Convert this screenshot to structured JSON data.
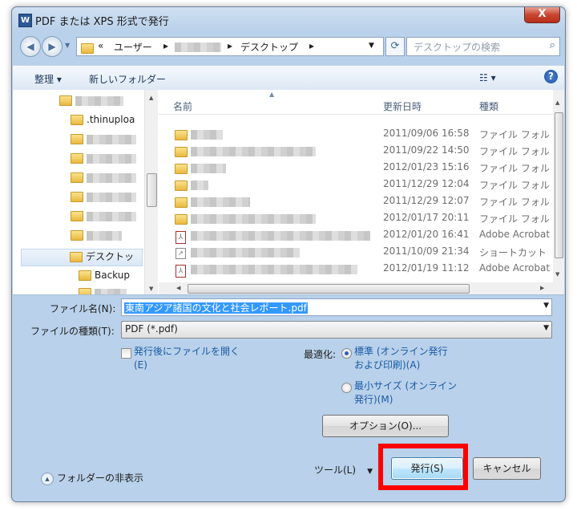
{
  "window": {
    "title": "PDF または XPS 形式で発行",
    "app_icon": "W",
    "close_label": "X"
  },
  "nav": {
    "back_icon": "◀",
    "forward_icon": "▶",
    "breadcrumb": [
      "«",
      "ユーザー",
      "▸",
      "▸",
      "デスクトップ",
      "▸"
    ],
    "search_placeholder": "デスクトップの検索"
  },
  "toolbar": {
    "organize": "整理 ▾",
    "new_folder": "新しいフォルダー",
    "view": "☷ ▾",
    "help": "?"
  },
  "tree": {
    "items": [
      ".thinuploa",
      "デスクトッ",
      "Backup"
    ]
  },
  "files": {
    "headers": {
      "name": "名前",
      "date": "更新日時",
      "type": "種類"
    },
    "rows": [
      {
        "date": "2011/09/06 16:58",
        "type": "ファイル フォル"
      },
      {
        "date": "2011/09/22 14:50",
        "type": "ファイル フォル"
      },
      {
        "date": "2012/01/23 15:16",
        "type": "ファイル フォル"
      },
      {
        "date": "2011/12/29 12:04",
        "type": "ファイル フォル"
      },
      {
        "date": "2011/12/29 12:07",
        "type": "ファイル フォル"
      },
      {
        "date": "2012/01/17 20:11",
        "type": "ファイル フォル"
      },
      {
        "date": "2012/01/20 16:41",
        "type": "Adobe Acrobat"
      },
      {
        "date": "2011/10/09 21:34",
        "type": "ショートカット"
      },
      {
        "date": "2012/01/19 11:12",
        "type": "Adobe Acrobat"
      }
    ]
  },
  "form": {
    "filename_label": "ファイル名(N):",
    "filename_value": "東南アジア諸国の文化と社会レポート.pdf",
    "filetype_label": "ファイルの種類(T):",
    "filetype_value": "PDF (*.pdf)",
    "open_after_line1": "発行後にファイルを開く",
    "open_after_line2": "(E)",
    "optimize_label": "最適化:",
    "standard_line1": "標準 (オンライン発行",
    "standard_line2": "および印刷)(A)",
    "minimum_line1": "最小サイズ (オンライン",
    "minimum_line2": "発行)(M)",
    "options_button": "オプション(O)..."
  },
  "footer": {
    "hide_folders": "フォルダーの非表示",
    "tools": "ツール(L)",
    "publish": "発行(S)",
    "cancel": "キャンセル"
  },
  "colors": {
    "highlight": "#ff0000",
    "selection": "#3399ff"
  }
}
